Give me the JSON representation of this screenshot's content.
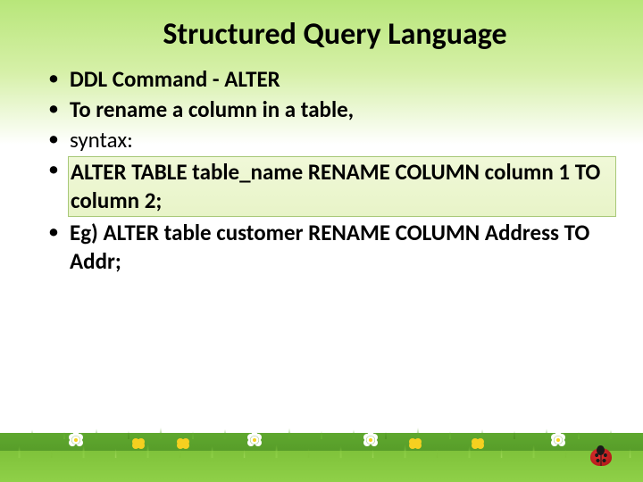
{
  "title": "Structured Query Language",
  "bullets": [
    {
      "text": "DDL  Command - ALTER",
      "bold": true
    },
    {
      "text": "To rename a column in a table,",
      "bold": true
    },
    {
      "text": " syntax:",
      "bold": false
    },
    {
      "text": "ALTER TABLE table_name RENAME COLUMN column 1 TO column 2;",
      "bold": true,
      "highlight": true
    },
    {
      "text": "Eg) ALTER table customer RENAME COLUMN Address TO Addr;",
      "bold": true
    }
  ]
}
